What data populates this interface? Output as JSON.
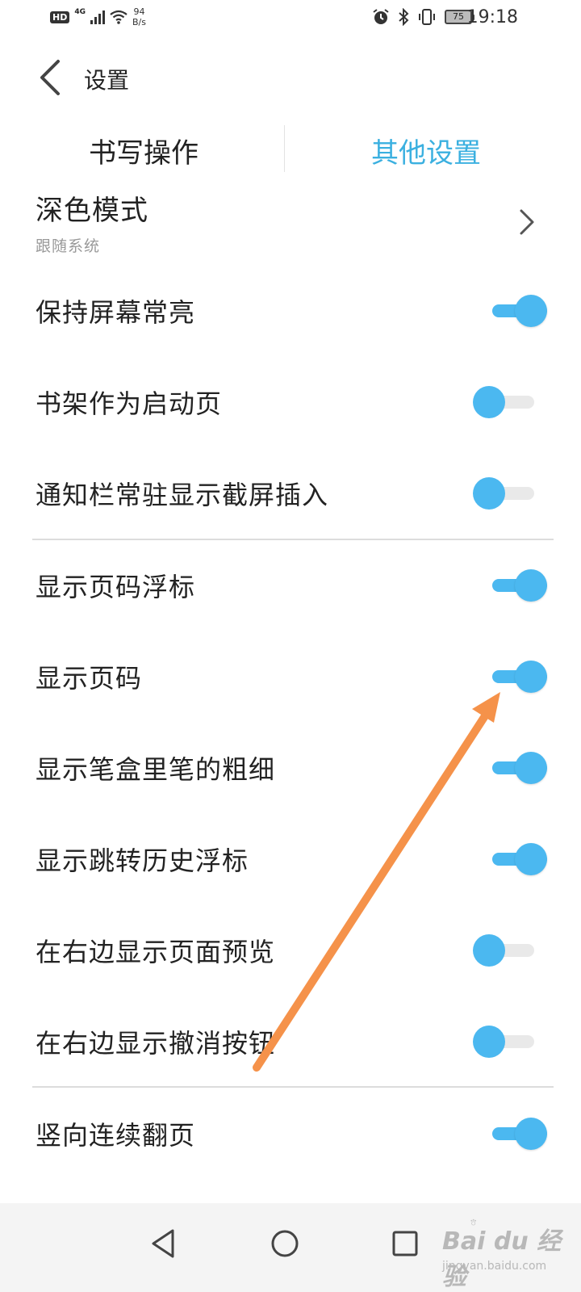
{
  "status_bar": {
    "hd": "HD",
    "network": "4G",
    "speed_value": "94",
    "speed_unit": "B/s",
    "battery": "75",
    "time": "19:18",
    "icons": [
      "alarm-icon",
      "bluetooth-icon",
      "vibrate-icon",
      "battery-icon"
    ]
  },
  "header": {
    "title": "设置",
    "back_icon": "back-chevron-icon"
  },
  "tabs": [
    {
      "label": "书写操作",
      "active": false
    },
    {
      "label": "其他设置",
      "active": true,
      "color": "#3bb0e0"
    }
  ],
  "dark_mode": {
    "label": "深色模式",
    "value": "跟随系统"
  },
  "settings": [
    {
      "label": "保持屏幕常亮",
      "on": true
    },
    {
      "label": "书架作为启动页",
      "on": false
    },
    {
      "label": "通知栏常驻显示截屏插入",
      "on": false
    },
    {
      "label": "显示页码浮标",
      "on": true
    },
    {
      "label": "显示页码",
      "on": true
    },
    {
      "label": "显示笔盒里笔的粗细",
      "on": true
    },
    {
      "label": "显示跳转历史浮标",
      "on": true
    },
    {
      "label": "在右边显示页面预览",
      "on": false
    },
    {
      "label": "在右边显示撤消按钮",
      "on": false
    },
    {
      "label": "竖向连续翻页",
      "on": true
    }
  ],
  "colors": {
    "accent": "#4bb8f0",
    "annotation_arrow": "#f5924a"
  },
  "watermark": {
    "brand": "Bai du 经验",
    "url": "jingyan.baidu.com"
  }
}
